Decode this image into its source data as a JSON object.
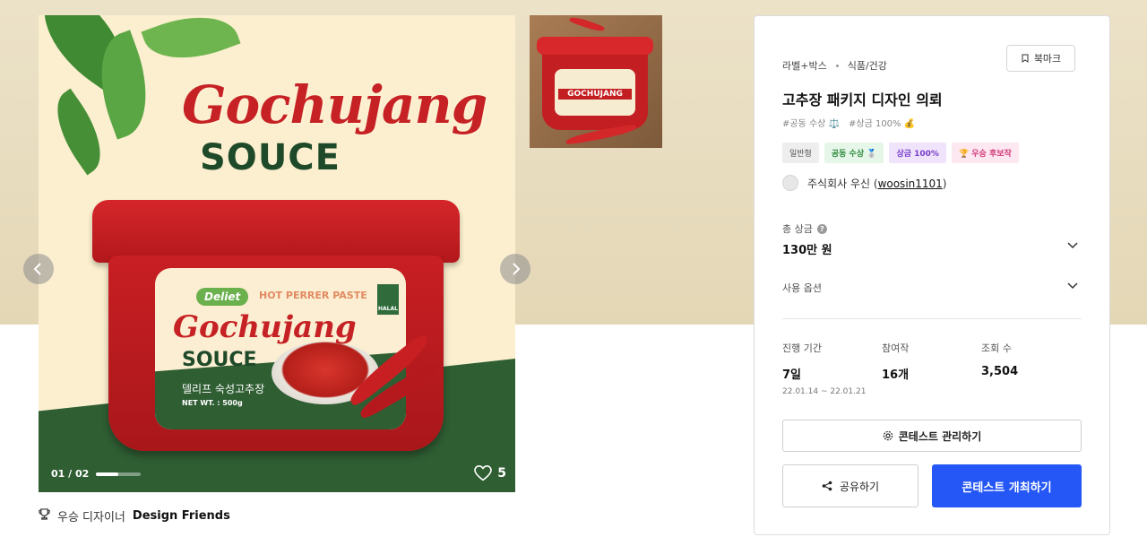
{
  "gallery": {
    "counter_current": "01",
    "counter_total": "02",
    "counter_separator": "/",
    "progress_fraction": 0.5,
    "likes": "5",
    "main_image": {
      "headline_script": "Gochujang",
      "headline_word": "SOUCE",
      "label_brand": "Deliet",
      "label_subtitle": "HOT PERRER PASTE",
      "label_script": "Gochujang",
      "label_word": "SOUCE",
      "label_korean": "델리프 숙성고추장",
      "label_net": "NET WT. : 500g",
      "halal": "HALAL"
    },
    "thumbnail": {
      "label": "GOCHUJANG"
    },
    "prev_icon": "chevron-left-icon",
    "next_icon": "chevron-right-icon"
  },
  "designer": {
    "icon": "trophy-icon",
    "prefix": "우승 디자이너",
    "name": "Design Friends"
  },
  "panel": {
    "bookmark_label": "북마크",
    "category": [
      "라벨+박스",
      "식품/건강"
    ],
    "title": "고추장 패키지 디자인 의뢰",
    "hashtags": [
      "#공동 수상 ⚖️",
      "#상금 100% 💰"
    ],
    "badges": [
      "일반형",
      "공동 수상 🥈",
      "상금 100%",
      "🏆 우승 후보작"
    ],
    "company_name": "주식회사 우신",
    "company_id": "woosin1101",
    "prize_label": "총 상금",
    "prize_help": "?",
    "prize_value": "130만 원",
    "options_label": "사용 옵션",
    "stats": {
      "period_label": "진행 기간",
      "period_value": "7일",
      "period_range": "22.01.14 ~ 22.01.21",
      "entries_label": "참여작",
      "entries_value": "16개",
      "views_label": "조회 수",
      "views_value": "3,504"
    },
    "manage_label": "콘테스트 관리하기",
    "share_label": "공유하기",
    "host_label": "콘테스트 개최하기"
  },
  "colors": {
    "band": "#e8dcbf",
    "primary": "#2457f5",
    "brand_red": "#c62124",
    "brand_green": "#2f5e33"
  }
}
